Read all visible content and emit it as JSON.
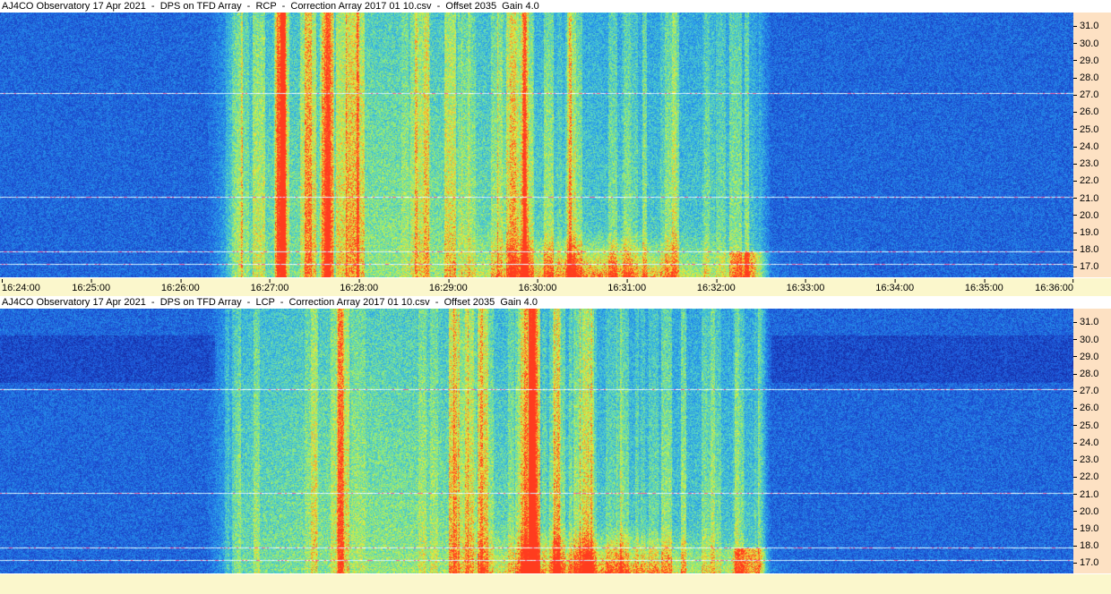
{
  "panels": [
    {
      "title": "AJ4CO Observatory 17 Apr 2021  -  DPS on TFD Array  -  RCP  -  Correction Array 2017 01 10.csv  -  Offset 2035  Gain 4.0",
      "polarization": "RCP"
    },
    {
      "title": "AJ4CO Observatory 17 Apr 2021  -  DPS on TFD Array  -  LCP  -  Correction Array 2017 01 10.csv  -  Offset 2035  Gain 4.0",
      "polarization": "LCP"
    }
  ],
  "frequency_axis": {
    "ticks": [
      "31.0",
      "30.0",
      "29.0",
      "28.0",
      "27.0",
      "26.0",
      "25.0",
      "24.0",
      "23.0",
      "22.0",
      "21.0",
      "20.0",
      "19.0",
      "18.0",
      "17.0"
    ],
    "range": [
      16.4,
      31.8
    ]
  },
  "time_axis": {
    "ticks": [
      "16:24:00",
      "16:25:00",
      "16:26:00",
      "16:27:00",
      "16:28:00",
      "16:29:00",
      "16:30:00",
      "16:31:00",
      "16:32:00",
      "16:33:00",
      "16:34:00",
      "16:35:00",
      "16:36:00"
    ]
  },
  "colors": {
    "background_low": "#1a3fb8",
    "mid": "#3aa0e8",
    "high": "#9be86a",
    "peak": "#ff7020",
    "yaxis_bg": "#fde1c3",
    "xaxis_bg": "#fbf7cc"
  }
}
